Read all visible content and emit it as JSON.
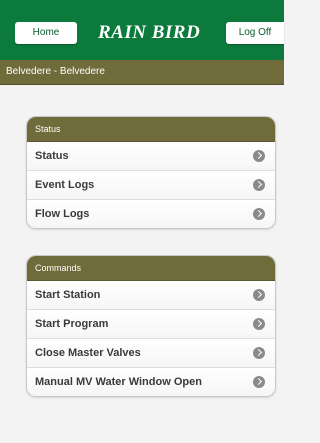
{
  "header": {
    "home_label": "Home",
    "logo_text": "RAIN BIRD",
    "logoff_label": "Log Off",
    "accent_color": "#0b7a3c"
  },
  "location": {
    "text": "Belvedere - Belvedere"
  },
  "status_section": {
    "title": "Status",
    "items": [
      {
        "label": "Status",
        "icon": "chevron-right-icon"
      },
      {
        "label": "Event Logs",
        "icon": "chevron-right-icon"
      },
      {
        "label": "Flow Logs",
        "icon": "chevron-right-icon"
      }
    ]
  },
  "commands_section": {
    "title": "Commands",
    "items": [
      {
        "label": "Start Station",
        "icon": "chevron-right-icon"
      },
      {
        "label": "Start Program",
        "icon": "chevron-right-icon"
      },
      {
        "label": "Close Master Valves",
        "icon": "chevron-right-icon"
      },
      {
        "label": "Manual MV Water Window Open",
        "icon": "chevron-right-icon"
      }
    ]
  },
  "colors": {
    "section_header": "#6f6b3b",
    "page_background": "#f3f3f3"
  }
}
